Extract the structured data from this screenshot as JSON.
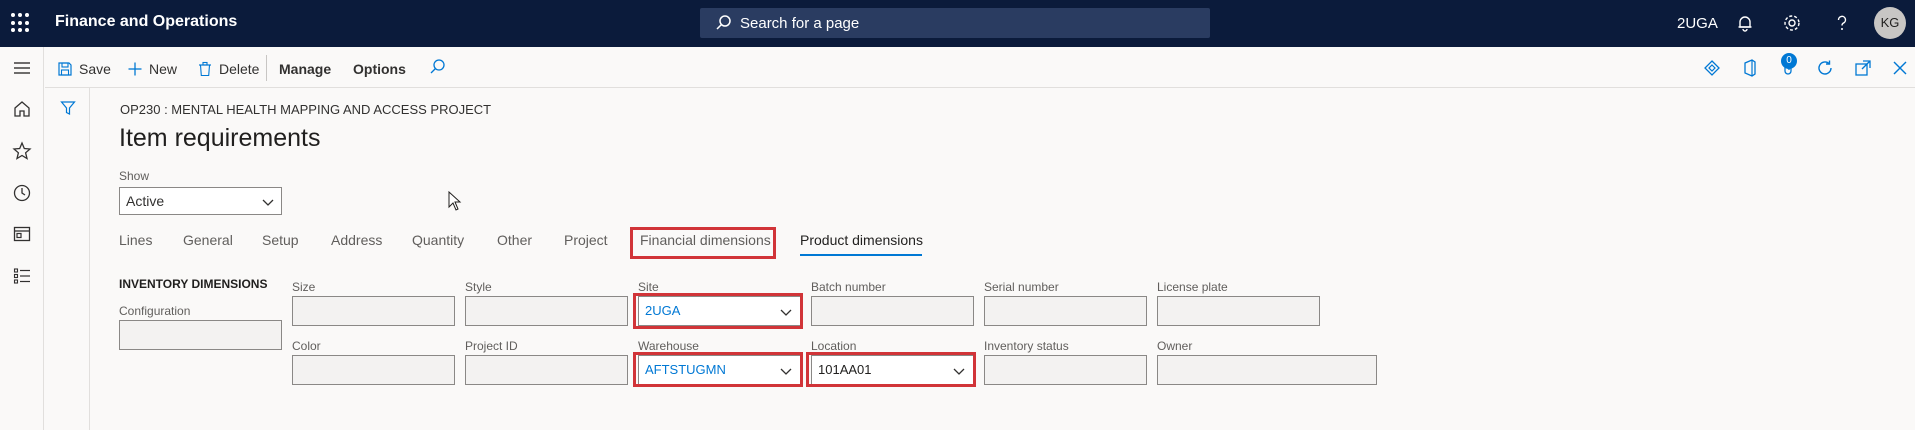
{
  "app": {
    "title": "Finance and Operations",
    "company": "2UGA",
    "user_initials": "KG"
  },
  "search": {
    "placeholder": "Search for a page"
  },
  "actions": {
    "save": "Save",
    "new": "New",
    "delete": "Delete",
    "manage": "Manage",
    "options": "Options",
    "notifications_count": "0"
  },
  "page": {
    "caption": "OP230 : MENTAL HEALTH MAPPING AND ACCESS PROJECT",
    "title": "Item requirements",
    "show_label": "Show",
    "show_value": "Active"
  },
  "tabs": [
    "Lines",
    "General",
    "Setup",
    "Address",
    "Quantity",
    "Other",
    "Project",
    "Financial dimensions",
    "Product dimensions"
  ],
  "active_tab": "Product dimensions",
  "inventory": {
    "section_title": "INVENTORY DIMENSIONS",
    "configuration_label": "Configuration",
    "size_label": "Size",
    "style_label": "Style",
    "site_label": "Site",
    "site_value": "2UGA",
    "batch_label": "Batch number",
    "serial_label": "Serial number",
    "license_label": "License plate",
    "color_label": "Color",
    "project_id_label": "Project ID",
    "warehouse_label": "Warehouse",
    "warehouse_value": "AFTSTUGMN",
    "location_label": "Location",
    "location_value": "101AA01",
    "inventory_status_label": "Inventory status",
    "owner_label": "Owner"
  },
  "colors": {
    "topbar": "#0b1b3b",
    "accent": "#0078d4",
    "highlight": "#d13438"
  }
}
